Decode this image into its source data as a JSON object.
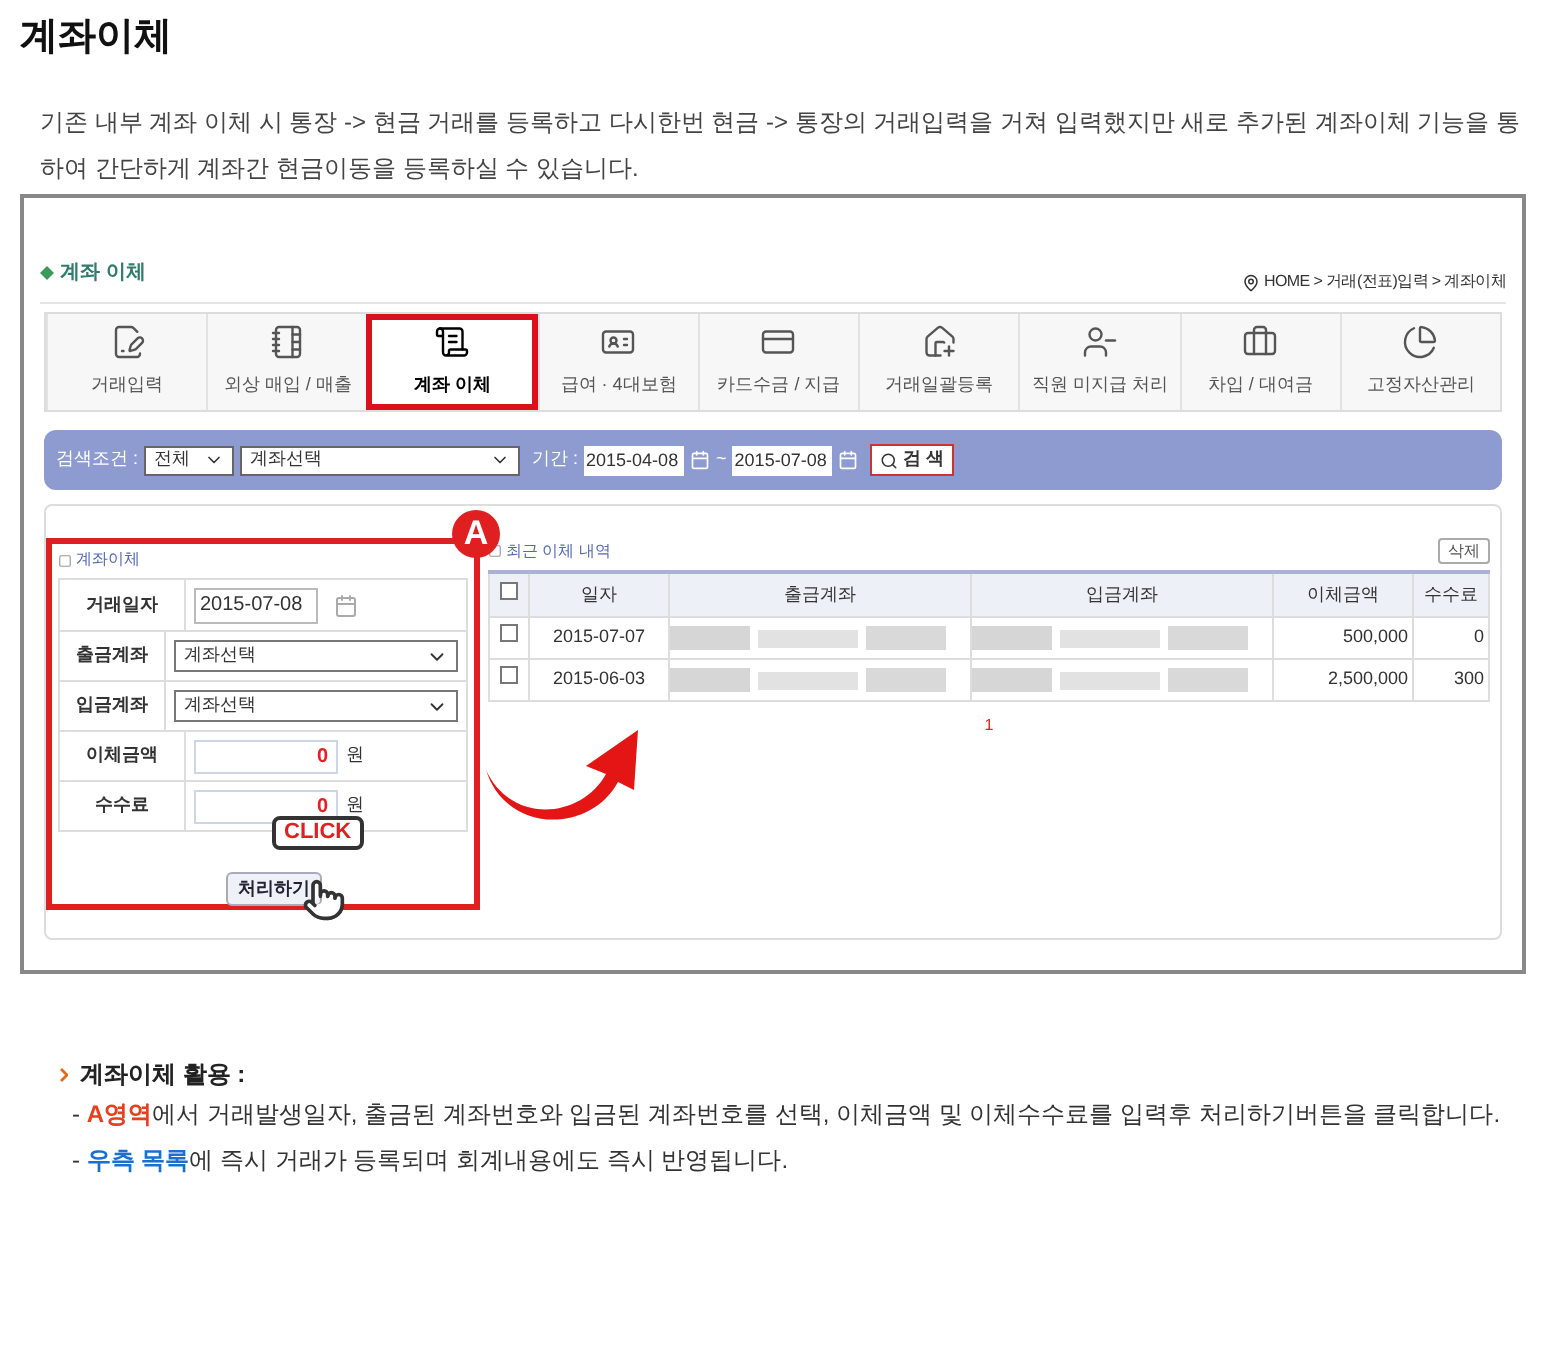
{
  "page_title": "계좌이체",
  "intro": "기존 내부 계좌 이체 시 통장 -> 현금 거래를 등록하고 다시한번 현금 -> 통장의 거래입력을 거쳐 입력했지만 새로 추가된 계좌이체 기능을 통하여 간단하게 계좌간 현금이동을 등록하실 수 있습니다.",
  "app": {
    "header": "계좌 이체",
    "breadcrumb": "HOME > 거래(전표)입력 > 계좌이체",
    "tabs": [
      {
        "label": "거래입력",
        "selected": false
      },
      {
        "label": "외상 매입 / 매출",
        "selected": false
      },
      {
        "label": "계좌 이체",
        "selected": true
      },
      {
        "label": "급여 · 4대보험",
        "selected": false
      },
      {
        "label": "카드수금 / 지급",
        "selected": false
      },
      {
        "label": "거래일괄등록",
        "selected": false
      },
      {
        "label": "직원 미지급 처리",
        "selected": false
      },
      {
        "label": "차입 / 대여금",
        "selected": false
      },
      {
        "label": "고정자산관리",
        "selected": false
      }
    ],
    "search": {
      "label": "검색조건 :",
      "scope": "전체",
      "account": "계좌선택",
      "period_label": "기간 :",
      "from": "2015-04-08",
      "tilde": "~",
      "to": "2015-07-08",
      "button": "검 색"
    },
    "form": {
      "title": "계좌이체",
      "badge": "A",
      "rows": [
        {
          "kind": "date",
          "label": "거래일자",
          "value": "2015-07-08"
        },
        {
          "kind": "select",
          "label": "출금계좌",
          "value": "계좌선택"
        },
        {
          "kind": "select",
          "label": "입금계좌",
          "value": "계좌선택"
        },
        {
          "kind": "amount",
          "label": "이체금액",
          "value": "0",
          "unit": "원"
        },
        {
          "kind": "amount",
          "label": "수수료",
          "value": "0",
          "unit": "원"
        }
      ],
      "submit": "처리하기",
      "callout": "CLICK"
    },
    "list": {
      "title": "최근 이체 내역",
      "delete": "삭제",
      "all_checked": false,
      "columns": [
        "일자",
        "출금계좌",
        "입금계좌",
        "이체금액",
        "수수료"
      ],
      "rows": [
        {
          "checked": false,
          "date": "2015-07-07",
          "amount": "500,000",
          "fee": "0"
        },
        {
          "checked": false,
          "date": "2015-06-03",
          "amount": "2,500,000",
          "fee": "300"
        }
      ],
      "page": "1"
    }
  },
  "notes": {
    "title": "계좌이체 활용 :",
    "lines": [
      [
        {
          "kind": "plain",
          "text": "- "
        },
        {
          "kind": "red",
          "text": "A영역"
        },
        {
          "kind": "plain",
          "text": "에서 거래발생일자, 출금된 계좌번호와 입금된 계좌번호를 선택, 이체금액 및 이체수수료를 입력후 처리하기버튼을 클릭합니다."
        }
      ],
      [
        {
          "kind": "plain",
          "text": "- "
        },
        {
          "kind": "blue",
          "text": "우측 목록"
        },
        {
          "kind": "plain",
          "text": "에 즉시 거래가 등록되며 회계내용에도 즉시 반영됩니다."
        }
      ]
    ]
  }
}
